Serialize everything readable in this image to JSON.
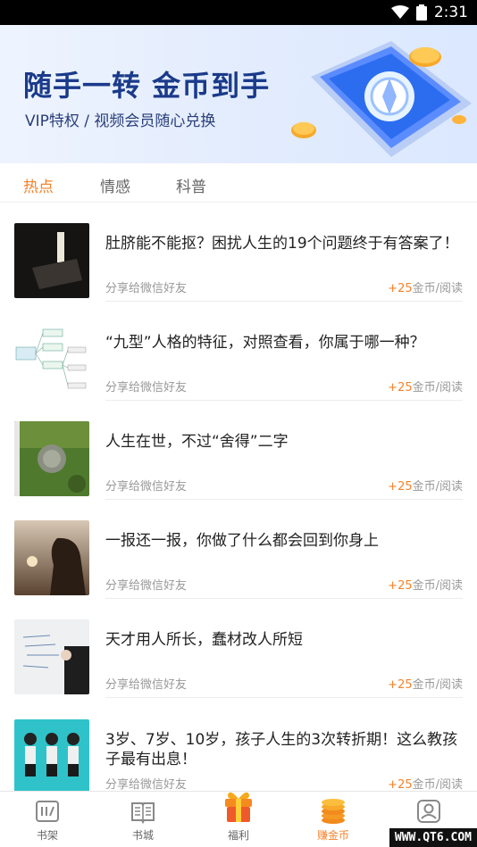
{
  "status_bar": {
    "time": "2:31"
  },
  "banner": {
    "title": "随手一转 金币到手",
    "subtitle": "VIP特权 / 视频会员随心兑换"
  },
  "tabs": [
    {
      "label": "热点",
      "active": true
    },
    {
      "label": "情感",
      "active": false
    },
    {
      "label": "科普",
      "active": false
    }
  ],
  "articles": [
    {
      "title": "肚脐能不能抠？困扰人生的19个问题终于有答案了！",
      "share": "分享给微信好友",
      "points": "+25",
      "reward_suffix": "金币/阅读"
    },
    {
      "title": "“九型”人格的特征，对照查看，你属于哪一种？",
      "share": "分享给微信好友",
      "points": "+25",
      "reward_suffix": "金币/阅读"
    },
    {
      "title": "人生在世，不过“舍得”二字",
      "share": "分享给微信好友",
      "points": "+25",
      "reward_suffix": "金币/阅读"
    },
    {
      "title": "一报还一报，你做了什么都会回到你身上",
      "share": "分享给微信好友",
      "points": "+25",
      "reward_suffix": "金币/阅读"
    },
    {
      "title": "天才用人所长，蠢材改人所短",
      "share": "分享给微信好友",
      "points": "+25",
      "reward_suffix": "金币/阅读"
    },
    {
      "title": "3岁、7岁、10岁，孩子人生的3次转折期！这么教孩子最有出息！",
      "share": "分享给微信好友",
      "points": "+25",
      "reward_suffix": "金币/阅读"
    }
  ],
  "bottom_nav": [
    {
      "label": "书架",
      "icon": "bookshelf-icon",
      "active": false
    },
    {
      "label": "书城",
      "icon": "book-icon",
      "active": false
    },
    {
      "label": "福利",
      "icon": "gift-icon",
      "active": false
    },
    {
      "label": "赚金币",
      "icon": "coins-icon",
      "active": true
    },
    {
      "label": "",
      "icon": "profile-icon",
      "active": false
    }
  ],
  "watermark": "WWW.QT6.COM",
  "colors": {
    "accent": "#f5822a",
    "banner_title": "#1a3a8a",
    "text": "#222222",
    "muted": "#999999"
  }
}
